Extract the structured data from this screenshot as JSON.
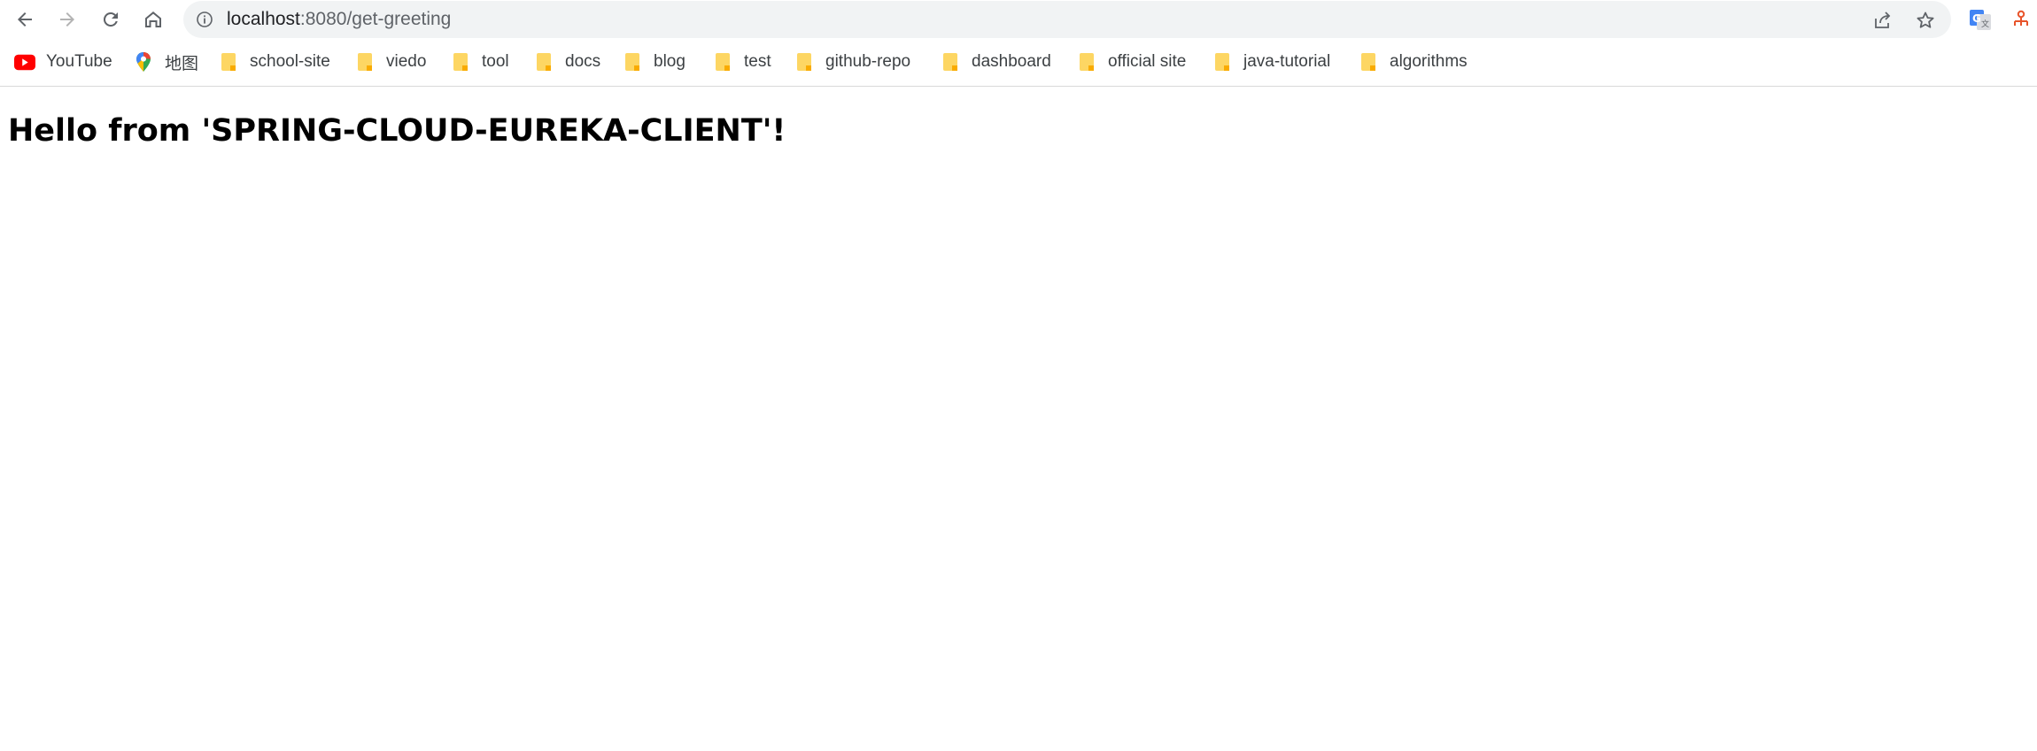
{
  "browser": {
    "url_host": "localhost",
    "url_rest": ":8080/get-greeting",
    "extensions": [
      {
        "name": "translate-extension-icon"
      },
      {
        "name": "extension-icon"
      }
    ]
  },
  "bookmarks": [
    {
      "label": "YouTube",
      "icon": "youtube-icon"
    },
    {
      "label": "地图",
      "icon": "maps-pin-icon"
    },
    {
      "label": "school-site",
      "icon": "folder-icon"
    },
    {
      "label": "viedo",
      "icon": "folder-icon"
    },
    {
      "label": "tool",
      "icon": "folder-icon"
    },
    {
      "label": "docs",
      "icon": "folder-icon"
    },
    {
      "label": "blog",
      "icon": "folder-icon"
    },
    {
      "label": "test",
      "icon": "folder-icon"
    },
    {
      "label": "github-repo",
      "icon": "folder-icon"
    },
    {
      "label": "dashboard",
      "icon": "folder-icon"
    },
    {
      "label": "official site",
      "icon": "folder-icon"
    },
    {
      "label": "java-tutorial",
      "icon": "folder-icon"
    },
    {
      "label": "algorithms",
      "icon": "folder-icon"
    }
  ],
  "page": {
    "heading": "Hello from 'SPRING-CLOUD-EUREKA-CLIENT'!"
  },
  "colors": {
    "folder": "#fdd663",
    "youtube": "#ff0000",
    "omnibox_bg": "#f1f3f4"
  }
}
